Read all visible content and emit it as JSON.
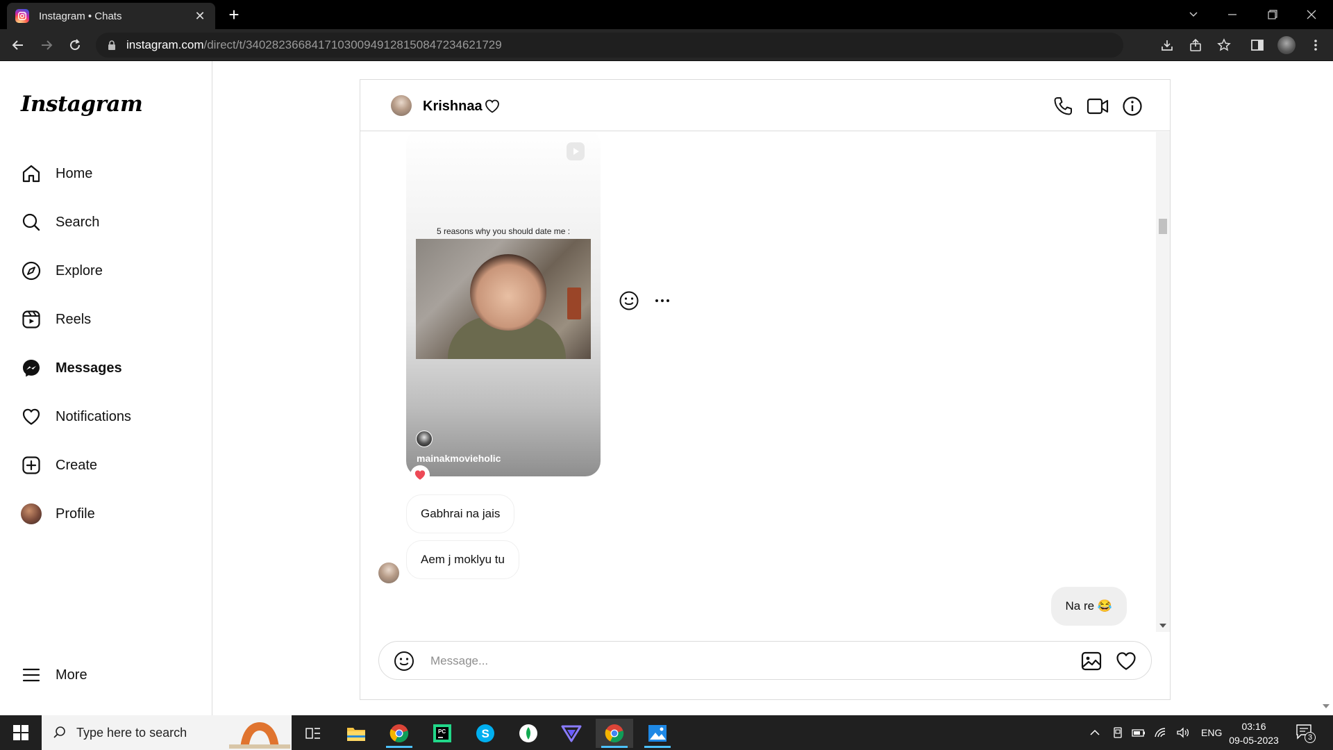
{
  "browser": {
    "tab_title": "Instagram • Chats",
    "url_host": "instagram.com",
    "url_path": "/direct/t/340282366841710300949128150847234621729"
  },
  "sidebar": {
    "logo": "Instagram",
    "items": [
      {
        "label": "Home",
        "icon": "home-icon"
      },
      {
        "label": "Search",
        "icon": "search-icon"
      },
      {
        "label": "Explore",
        "icon": "compass-icon"
      },
      {
        "label": "Reels",
        "icon": "reels-icon"
      },
      {
        "label": "Messages",
        "icon": "messenger-icon",
        "active": true
      },
      {
        "label": "Notifications",
        "icon": "heart-icon"
      },
      {
        "label": "Create",
        "icon": "plus-square-icon"
      },
      {
        "label": "Profile",
        "icon": "avatar"
      }
    ],
    "more_label": "More"
  },
  "chat": {
    "contact_name": "Krishnaa",
    "shared_reel": {
      "caption": "5 reasons why you should date me :",
      "author": "mainakmovieholic",
      "reaction": "heart"
    },
    "messages": [
      {
        "text": "Gabhrai na jais",
        "from": "them"
      },
      {
        "text": "Aem j moklyu tu",
        "from": "them"
      },
      {
        "text": "Na re 😂",
        "from": "me"
      }
    ],
    "composer_placeholder": "Message..."
  },
  "taskbar": {
    "search_placeholder": "Type here to search",
    "language": "ENG",
    "time": "03:16",
    "date": "09-05-2023",
    "notification_count": "3"
  },
  "colors": {
    "reaction_heart": "#ed4956",
    "browser_chrome": "#262626",
    "taskbar": "#202020"
  }
}
